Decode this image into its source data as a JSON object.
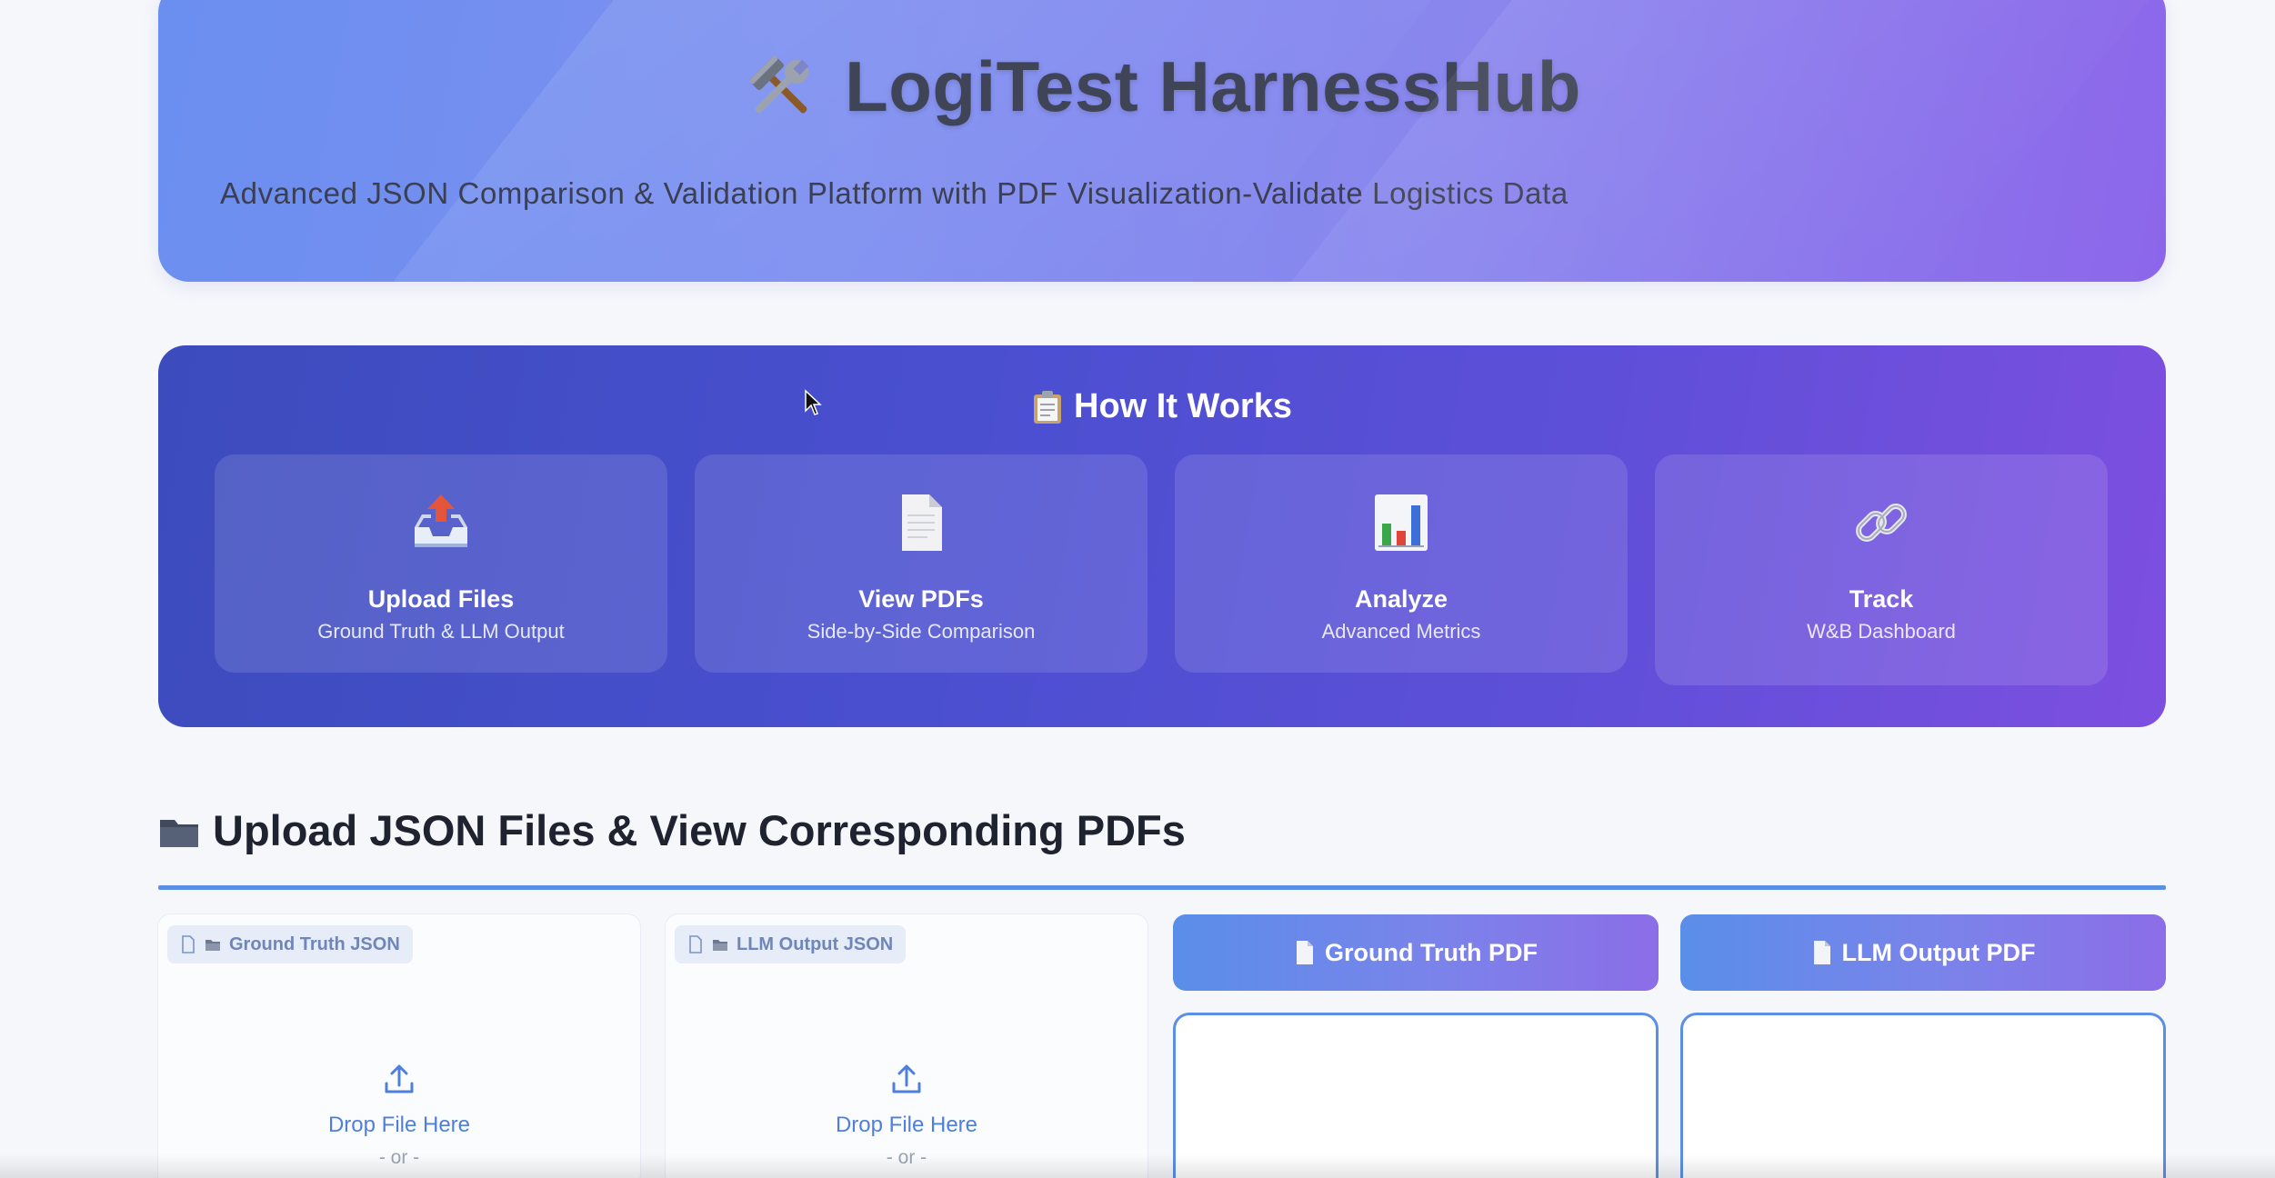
{
  "hero": {
    "title": "LogiTest HarnessHub",
    "title_icon": "hammer-and-wrench-icon",
    "subtitle": "Advanced JSON Comparison & Validation Platform with PDF Visualization-Validate Logistics Data"
  },
  "how_it_works": {
    "title": "How It Works",
    "title_icon": "clipboard-icon",
    "steps": [
      {
        "icon": "inbox-tray-upload-icon",
        "label": "Upload Files",
        "sub": "Ground Truth & LLM Output"
      },
      {
        "icon": "document-icon",
        "label": "View PDFs",
        "sub": "Side-by-Side Comparison"
      },
      {
        "icon": "bar-chart-icon",
        "label": "Analyze",
        "sub": "Advanced Metrics"
      },
      {
        "icon": "link-icon",
        "label": "Track",
        "sub": "W&B Dashboard"
      }
    ]
  },
  "upload_section": {
    "title": "Upload JSON Files & View Corresponding PDFs",
    "title_icon": "folder-icon",
    "uploaders": [
      {
        "label": "Ground Truth JSON",
        "drop_text": "Drop File Here",
        "or_text": "- or -"
      },
      {
        "label": "LLM Output JSON",
        "drop_text": "Drop File Here",
        "or_text": "- or -"
      }
    ],
    "pdf_panels": [
      {
        "label": "Ground Truth PDF"
      },
      {
        "label": "LLM Output PDF"
      }
    ]
  },
  "colors": {
    "hero_gradient_start": "#6a8ff0",
    "hero_gradient_end": "#8c66ea",
    "how_gradient_start": "#3c4cbd",
    "how_gradient_end": "#7d4fe0",
    "accent": "#5b8fe6",
    "link_text": "#4e7fdc"
  }
}
